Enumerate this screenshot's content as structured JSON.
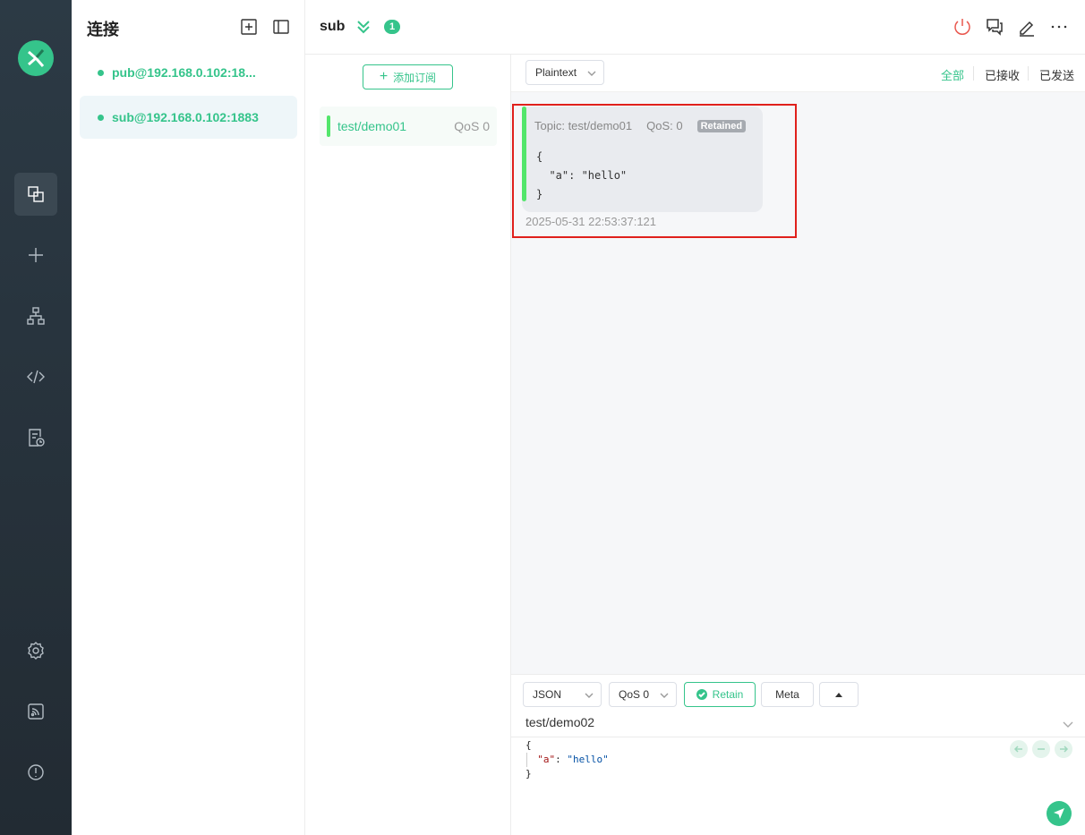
{
  "sidebar": {
    "title": "连接",
    "connections": [
      {
        "label": "pub@192.168.0.102:18...",
        "status_color": "#35c48b"
      },
      {
        "label": "sub@192.168.0.102:1883",
        "status_color": "#35c48b"
      }
    ],
    "nav_icons": [
      "connections-icon",
      "plus-icon",
      "topology-icon",
      "script-icon",
      "log-icon",
      "settings-icon",
      "feed-icon",
      "info-icon"
    ]
  },
  "topbar": {
    "connection_name": "sub",
    "unread_badge": "1"
  },
  "subscriptions": {
    "add_label": "添加订阅",
    "items": [
      {
        "topic": "test/demo01",
        "qos": "QoS 0",
        "color": "#53e66b"
      }
    ]
  },
  "messages": {
    "format": "Plaintext",
    "filters": {
      "all": "全部",
      "received": "已接收",
      "sent": "已发送"
    },
    "items": [
      {
        "topic": "Topic: test/demo01",
        "qos": "QoS: 0",
        "retained": "Retained",
        "payload": "{\n  \"a\": \"hello\"\n}",
        "time": "2025-05-31 22:53:37:121"
      }
    ]
  },
  "publish": {
    "format": "JSON",
    "qos": "QoS 0",
    "retain_label": "Retain",
    "meta_label": "Meta",
    "topic": "test/demo02",
    "payload_lines": [
      "{",
      "\"a\"",
      ": ",
      "\"hello\"",
      "}"
    ]
  },
  "colors": {
    "accent": "#35c48b",
    "sub_bar": "#53e66b",
    "highlight": "#e0201c",
    "rail": "#2c3a45"
  }
}
